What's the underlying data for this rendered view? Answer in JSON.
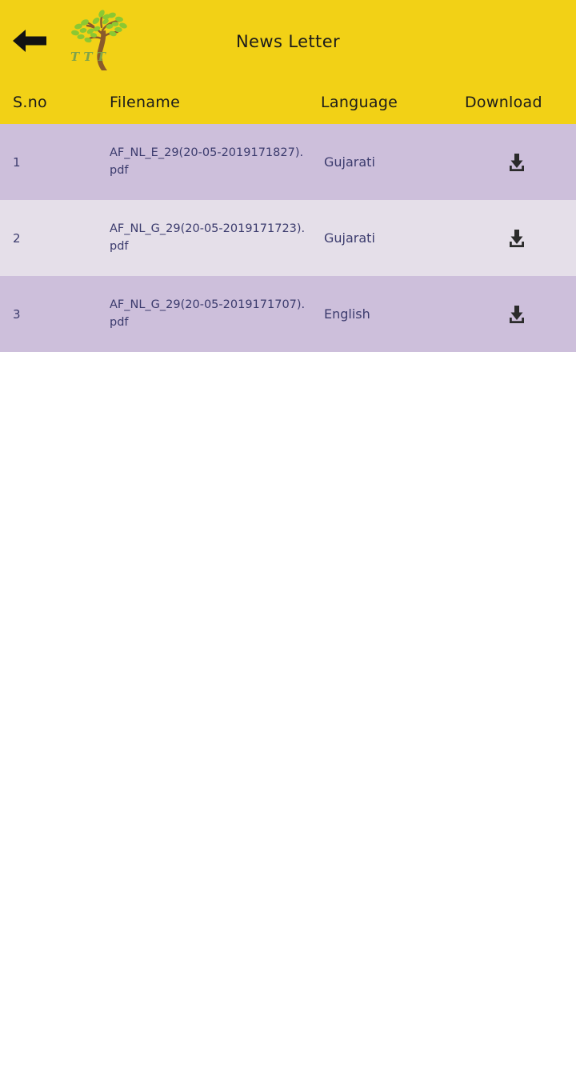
{
  "appbar": {
    "back_icon": "arrow-left-icon",
    "logo_icon": "tree-logo-icon",
    "logo_text": "T T T",
    "title": "News Letter",
    "background_color": "#F2D116"
  },
  "table": {
    "headers": {
      "sno": "S.no",
      "filename": "Filename",
      "language": "Language",
      "download": "Download"
    },
    "row_colors": {
      "odd": "#CDBFDB",
      "even": "#E5DFE9"
    },
    "text_color": "#3B3B6D",
    "download_icon": "download-icon",
    "rows": [
      {
        "sno": "1",
        "filename": "AF_NL_E_29(20-05-2019171827).pdf",
        "language": "Gujarati"
      },
      {
        "sno": "2",
        "filename": "AF_NL_G_29(20-05-2019171723).pdf",
        "language": "Gujarati"
      },
      {
        "sno": "3",
        "filename": "AF_NL_G_29(20-05-2019171707).pdf",
        "language": "English"
      }
    ]
  }
}
